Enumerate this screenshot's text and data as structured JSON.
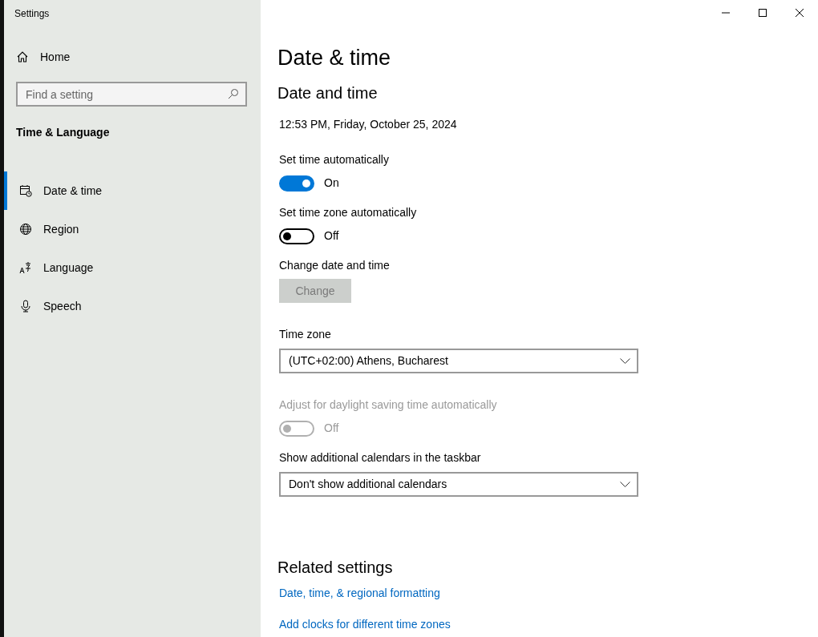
{
  "window": {
    "title": "Settings"
  },
  "sidebar": {
    "home": "Home",
    "search": {
      "placeholder": "Find a setting"
    },
    "section": "Time & Language",
    "items": [
      {
        "label": "Date & time",
        "kind": "calendar-clock",
        "selected": true
      },
      {
        "label": "Region",
        "kind": "globe",
        "selected": false
      },
      {
        "label": "Language",
        "kind": "language",
        "selected": false
      },
      {
        "label": "Speech",
        "kind": "microphone",
        "selected": false
      }
    ]
  },
  "page": {
    "title": "Date & time",
    "section": "Date and time",
    "current": "12:53 PM, Friday, October 25, 2024",
    "controls": [
      {
        "kind": "toggle",
        "label": "Set time automatically",
        "on": true,
        "disabled": false,
        "state_text": "On"
      },
      {
        "kind": "toggle",
        "label": "Set time zone automatically",
        "on": false,
        "disabled": false,
        "state_text": "Off"
      },
      {
        "kind": "button",
        "label": "Change date and time",
        "button": "Change",
        "disabled": true
      },
      {
        "kind": "dropdown",
        "label": "Time zone",
        "value": "(UTC+02:00) Athens, Bucharest"
      },
      {
        "kind": "toggle",
        "label": "Adjust for daylight saving time automatically",
        "on": false,
        "disabled": true,
        "state_text": "Off"
      },
      {
        "kind": "dropdown",
        "label": "Show additional calendars in the taskbar",
        "value": "Don't show additional calendars"
      }
    ],
    "related": {
      "title": "Related settings",
      "links": [
        "Date, time, & regional formatting",
        "Add clocks for different time zones"
      ]
    }
  }
}
